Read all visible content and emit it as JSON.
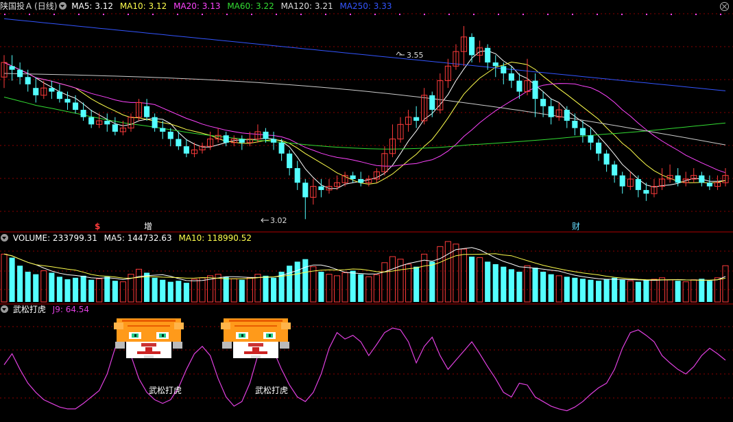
{
  "header": {
    "stock_name": "陕国投Ａ",
    "period": "(日线)",
    "ma5_label": "MA5: 3.12",
    "ma10_label": "MA10: 3.12",
    "ma20_label": "MA20: 3.13",
    "ma60_label": "MA60: 3.22",
    "ma120_label": "MA120: 3.21",
    "ma250_label": "MA250: 3.33"
  },
  "volume_header": {
    "volume_label": "VOLUME: 233799.31",
    "ma5_label": "MA5: 144732.63",
    "ma10_label": "MA10: 118990.52"
  },
  "indicator_header": {
    "name": "武松打虎",
    "j9_label": "J9: 64.54"
  },
  "annotations": {
    "high_label": "3.55",
    "low_label": "3.02",
    "marker_dollar": "$",
    "marker_zeng": "增",
    "marker_cai": "财",
    "tiger_caption": "武松打虎"
  },
  "colors": {
    "background": "#000000",
    "up_candle": "#ff3b3b",
    "down_candle": "#54ffff",
    "ma5": "#ffffff",
    "ma10": "#ffff4d",
    "ma20": "#ff44ff",
    "ma60": "#33dd33",
    "ma120": "#cccccc",
    "ma250": "#3355ff",
    "grid": "#8b0000",
    "j9": "#e040e0"
  },
  "chart_data": [
    {
      "type": "candlestick",
      "title": "陕国投Ａ (日线)",
      "ylim": [
        3.0,
        3.58
      ],
      "high_point": 3.55,
      "low_point": 3.02,
      "candles": [
        [
          3.41,
          3.45,
          3.38,
          3.47
        ],
        [
          3.44,
          3.43,
          3.4,
          3.47
        ],
        [
          3.43,
          3.41,
          3.39,
          3.45
        ],
        [
          3.41,
          3.39,
          3.37,
          3.43
        ],
        [
          3.38,
          3.36,
          3.34,
          3.41
        ],
        [
          3.36,
          3.38,
          3.35,
          3.4
        ],
        [
          3.38,
          3.37,
          3.35,
          3.4
        ],
        [
          3.37,
          3.35,
          3.34,
          3.39
        ],
        [
          3.35,
          3.34,
          3.32,
          3.37
        ],
        [
          3.34,
          3.32,
          3.31,
          3.36
        ],
        [
          3.32,
          3.3,
          3.29,
          3.34
        ],
        [
          3.3,
          3.28,
          3.27,
          3.32
        ],
        [
          3.28,
          3.29,
          3.27,
          3.31
        ],
        [
          3.29,
          3.28,
          3.26,
          3.31
        ],
        [
          3.28,
          3.26,
          3.25,
          3.3
        ],
        [
          3.26,
          3.27,
          3.25,
          3.29
        ],
        [
          3.27,
          3.3,
          3.26,
          3.31
        ],
        [
          3.3,
          3.34,
          3.29,
          3.35
        ],
        [
          3.33,
          3.3,
          3.29,
          3.35
        ],
        [
          3.3,
          3.27,
          3.26,
          3.31
        ],
        [
          3.27,
          3.26,
          3.24,
          3.29
        ],
        [
          3.26,
          3.24,
          3.22,
          3.27
        ],
        [
          3.24,
          3.22,
          3.21,
          3.26
        ],
        [
          3.22,
          3.2,
          3.19,
          3.24
        ],
        [
          3.2,
          3.21,
          3.19,
          3.23
        ],
        [
          3.21,
          3.22,
          3.2,
          3.23
        ],
        [
          3.22,
          3.24,
          3.21,
          3.26
        ],
        [
          3.24,
          3.25,
          3.23,
          3.27
        ],
        [
          3.25,
          3.23,
          3.22,
          3.26
        ],
        [
          3.23,
          3.24,
          3.22,
          3.25
        ],
        [
          3.24,
          3.23,
          3.21,
          3.25
        ],
        [
          3.23,
          3.24,
          3.22,
          3.26
        ],
        [
          3.24,
          3.26,
          3.23,
          3.28
        ],
        [
          3.26,
          3.24,
          3.23,
          3.27
        ],
        [
          3.24,
          3.23,
          3.21,
          3.26
        ],
        [
          3.23,
          3.2,
          3.18,
          3.24
        ],
        [
          3.2,
          3.16,
          3.14,
          3.21
        ],
        [
          3.16,
          3.12,
          3.1,
          3.18
        ],
        [
          3.12,
          3.08,
          3.02,
          3.13
        ],
        [
          3.08,
          3.11,
          3.06,
          3.13
        ],
        [
          3.11,
          3.1,
          3.08,
          3.13
        ],
        [
          3.1,
          3.11,
          3.09,
          3.13
        ],
        [
          3.11,
          3.12,
          3.1,
          3.14
        ],
        [
          3.12,
          3.14,
          3.11,
          3.15
        ],
        [
          3.14,
          3.13,
          3.12,
          3.15
        ],
        [
          3.13,
          3.12,
          3.11,
          3.15
        ],
        [
          3.12,
          3.13,
          3.11,
          3.14
        ],
        [
          3.13,
          3.15,
          3.12,
          3.16
        ],
        [
          3.15,
          3.2,
          3.14,
          3.22
        ],
        [
          3.2,
          3.24,
          3.19,
          3.28
        ],
        [
          3.24,
          3.28,
          3.23,
          3.3
        ],
        [
          3.28,
          3.3,
          3.26,
          3.32
        ],
        [
          3.3,
          3.29,
          3.27,
          3.33
        ],
        [
          3.29,
          3.36,
          3.28,
          3.38
        ],
        [
          3.36,
          3.32,
          3.3,
          3.37
        ],
        [
          3.32,
          3.4,
          3.31,
          3.42
        ],
        [
          3.4,
          3.44,
          3.38,
          3.46
        ],
        [
          3.44,
          3.48,
          3.43,
          3.5
        ],
        [
          3.48,
          3.52,
          3.44,
          3.55
        ],
        [
          3.52,
          3.47,
          3.45,
          3.53
        ],
        [
          3.47,
          3.49,
          3.45,
          3.51
        ],
        [
          3.49,
          3.45,
          3.43,
          3.5
        ],
        [
          3.45,
          3.44,
          3.41,
          3.47
        ],
        [
          3.44,
          3.42,
          3.39,
          3.45
        ],
        [
          3.42,
          3.4,
          3.38,
          3.44
        ],
        [
          3.4,
          3.37,
          3.35,
          3.42
        ],
        [
          3.37,
          3.4,
          3.36,
          3.46
        ],
        [
          3.4,
          3.35,
          3.3,
          3.42
        ],
        [
          3.35,
          3.33,
          3.3,
          3.37
        ],
        [
          3.33,
          3.3,
          3.28,
          3.35
        ],
        [
          3.3,
          3.32,
          3.29,
          3.34
        ],
        [
          3.32,
          3.29,
          3.27,
          3.33
        ],
        [
          3.29,
          3.27,
          3.25,
          3.31
        ],
        [
          3.27,
          3.25,
          3.23,
          3.29
        ],
        [
          3.25,
          3.23,
          3.21,
          3.27
        ],
        [
          3.23,
          3.2,
          3.18,
          3.24
        ],
        [
          3.2,
          3.17,
          3.15,
          3.21
        ],
        [
          3.17,
          3.14,
          3.12,
          3.18
        ],
        [
          3.14,
          3.11,
          3.09,
          3.15
        ],
        [
          3.11,
          3.13,
          3.1,
          3.15
        ],
        [
          3.13,
          3.1,
          3.08,
          3.14
        ],
        [
          3.1,
          3.09,
          3.07,
          3.12
        ],
        [
          3.09,
          3.11,
          3.08,
          3.13
        ],
        [
          3.11,
          3.13,
          3.1,
          3.16
        ],
        [
          3.13,
          3.14,
          3.12,
          3.17
        ],
        [
          3.14,
          3.12,
          3.11,
          3.16
        ],
        [
          3.12,
          3.13,
          3.11,
          3.15
        ],
        [
          3.13,
          3.14,
          3.12,
          3.16
        ],
        [
          3.14,
          3.12,
          3.11,
          3.15
        ],
        [
          3.12,
          3.11,
          3.1,
          3.14
        ],
        [
          3.11,
          3.12,
          3.1,
          3.14
        ],
        [
          3.12,
          3.14,
          3.11,
          3.16
        ]
      ]
    },
    {
      "type": "bar",
      "title": "VOLUME",
      "values": [
        95,
        88,
        72,
        60,
        55,
        62,
        58,
        50,
        45,
        48,
        52,
        44,
        46,
        50,
        42,
        40,
        55,
        65,
        58,
        48,
        44,
        40,
        42,
        38,
        45,
        48,
        52,
        55,
        50,
        46,
        44,
        48,
        55,
        52,
        48,
        60,
        72,
        80,
        85,
        70,
        60,
        55,
        52,
        58,
        62,
        55,
        50,
        54,
        78,
        90,
        85,
        75,
        70,
        95,
        80,
        110,
        120,
        115,
        105,
        90,
        88,
        80,
        75,
        70,
        65,
        60,
        72,
        68,
        60,
        55,
        52,
        50,
        48,
        46,
        44,
        42,
        45,
        48,
        44,
        42,
        40,
        43,
        45,
        48,
        44,
        42,
        40,
        44,
        46,
        42,
        48,
        72
      ]
    },
    {
      "type": "line",
      "title": "武松打虎",
      "series": [
        {
          "name": "J9",
          "values": [
            60,
            72,
            55,
            40,
            30,
            22,
            18,
            14,
            12,
            12,
            18,
            25,
            32,
            50,
            78,
            95,
            70,
            45,
            30,
            22,
            18,
            22,
            35,
            55,
            72,
            80,
            70,
            45,
            25,
            15,
            20,
            40,
            70,
            90,
            75,
            55,
            38,
            25,
            20,
            30,
            50,
            78,
            95,
            88,
            92,
            85,
            70,
            82,
            95,
            100,
            98,
            85,
            62,
            80,
            90,
            70,
            55,
            65,
            75,
            85,
            72,
            58,
            45,
            30,
            25,
            40,
            38,
            25,
            20,
            15,
            12,
            10,
            14,
            20,
            28,
            35,
            40,
            55,
            78,
            95,
            98,
            92,
            85,
            70,
            62,
            55,
            50,
            58,
            70,
            78,
            72,
            65
          ]
        }
      ]
    }
  ]
}
